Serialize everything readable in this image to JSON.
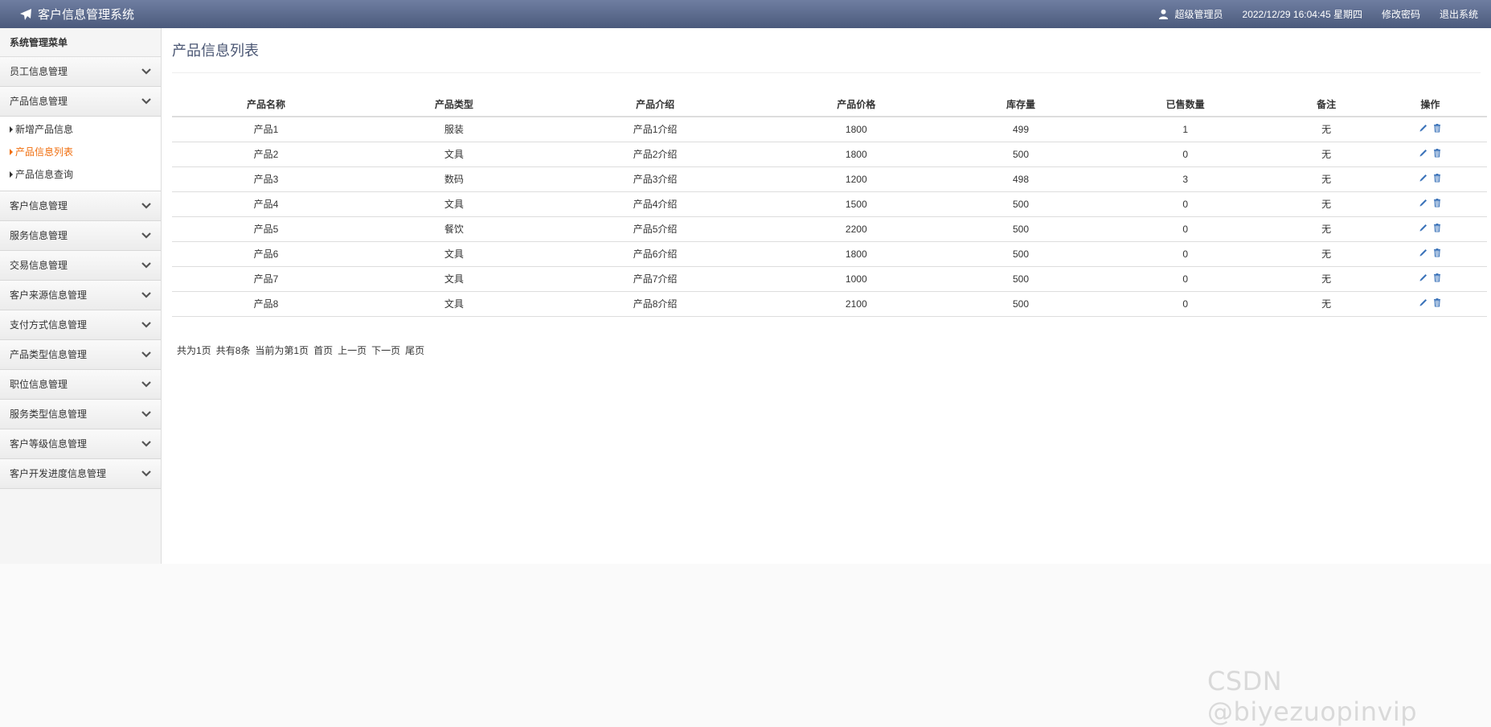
{
  "header": {
    "app_title": "客户信息管理系统",
    "user": "超级管理员",
    "datetime": "2022/12/29 16:04:45 星期四",
    "change_password": "修改密码",
    "logout": "退出系统"
  },
  "sidebar": {
    "title": "系统管理菜单",
    "groups": [
      {
        "label": "员工信息管理"
      },
      {
        "label": "产品信息管理",
        "expanded": true,
        "items": [
          {
            "label": "新增产品信息"
          },
          {
            "label": "产品信息列表",
            "active": true
          },
          {
            "label": "产品信息查询"
          }
        ]
      },
      {
        "label": "客户信息管理"
      },
      {
        "label": "服务信息管理"
      },
      {
        "label": "交易信息管理"
      },
      {
        "label": "客户来源信息管理"
      },
      {
        "label": "支付方式信息管理"
      },
      {
        "label": "产品类型信息管理"
      },
      {
        "label": "职位信息管理"
      },
      {
        "label": "服务类型信息管理"
      },
      {
        "label": "客户等级信息管理"
      },
      {
        "label": "客户开发进度信息管理"
      }
    ]
  },
  "main": {
    "title": "产品信息列表",
    "columns": [
      "产品名称",
      "产品类型",
      "产品介绍",
      "产品价格",
      "库存量",
      "已售数量",
      "备注",
      "操作"
    ],
    "rows": [
      [
        "产品1",
        "服装",
        "产品1介绍",
        "1800",
        "499",
        "1",
        "无"
      ],
      [
        "产品2",
        "文具",
        "产品2介绍",
        "1800",
        "500",
        "0",
        "无"
      ],
      [
        "产品3",
        "数码",
        "产品3介绍",
        "1200",
        "498",
        "3",
        "无"
      ],
      [
        "产品4",
        "文具",
        "产品4介绍",
        "1500",
        "500",
        "0",
        "无"
      ],
      [
        "产品5",
        "餐饮",
        "产品5介绍",
        "2200",
        "500",
        "0",
        "无"
      ],
      [
        "产品6",
        "文具",
        "产品6介绍",
        "1800",
        "500",
        "0",
        "无"
      ],
      [
        "产品7",
        "文具",
        "产品7介绍",
        "1000",
        "500",
        "0",
        "无"
      ],
      [
        "产品8",
        "文具",
        "产品8介绍",
        "2100",
        "500",
        "0",
        "无"
      ]
    ],
    "row_actions": {
      "edit_icon": "pencil-icon",
      "delete_icon": "trash-icon"
    },
    "pager": {
      "total_pages": "共为1页",
      "total_count": "共有8条",
      "current": "当前为第1页",
      "first": "首页",
      "prev": "上一页",
      "next": "下一页",
      "last": "尾页"
    }
  },
  "watermark": "CSDN @biyezuopinvip",
  "colors": {
    "header_top": "#6f7ea1",
    "header_bottom": "#4b5a7c",
    "active_menu": "#f06d0c",
    "icon_blue": "#3b73b9",
    "title": "#4a5673"
  }
}
